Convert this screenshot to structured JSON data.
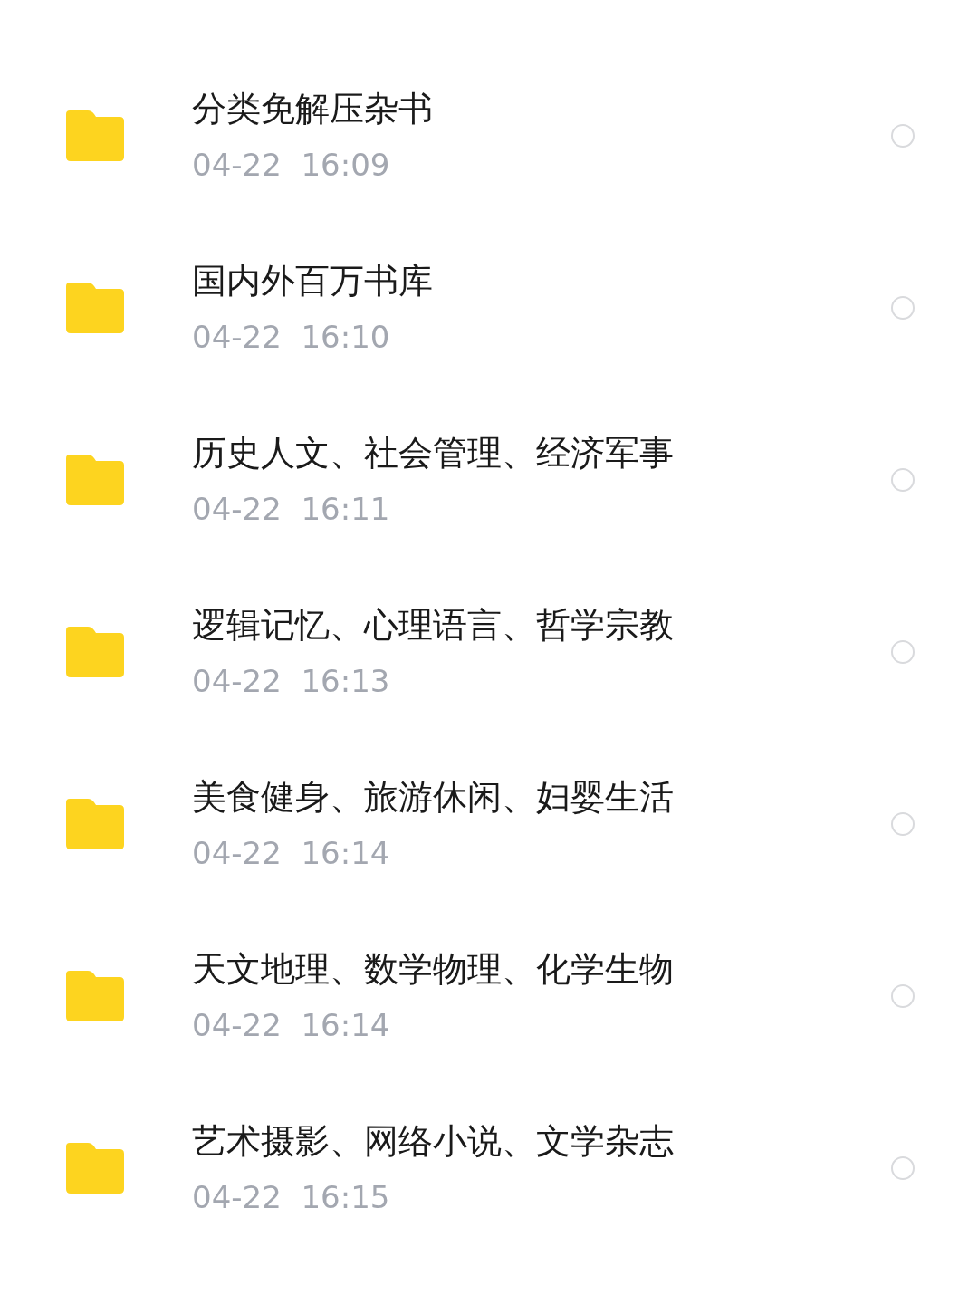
{
  "folders": [
    {
      "name": "分类免解压杂书",
      "date": "04-22  16:09",
      "selected": false
    },
    {
      "name": "国内外百万书库",
      "date": "04-22  16:10",
      "selected": false
    },
    {
      "name": "历史人文、社会管理、经济军事",
      "date": "04-22  16:11",
      "selected": false
    },
    {
      "name": "逻辑记忆、心理语言、哲学宗教",
      "date": "04-22  16:13",
      "selected": false
    },
    {
      "name": "美食健身、旅游休闲、妇婴生活",
      "date": "04-22  16:14",
      "selected": false
    },
    {
      "name": "天文地理、数学物理、化学生物",
      "date": "04-22  16:14",
      "selected": false
    },
    {
      "name": "艺术摄影、网络小说、文学杂志",
      "date": "04-22  16:15",
      "selected": false
    }
  ]
}
